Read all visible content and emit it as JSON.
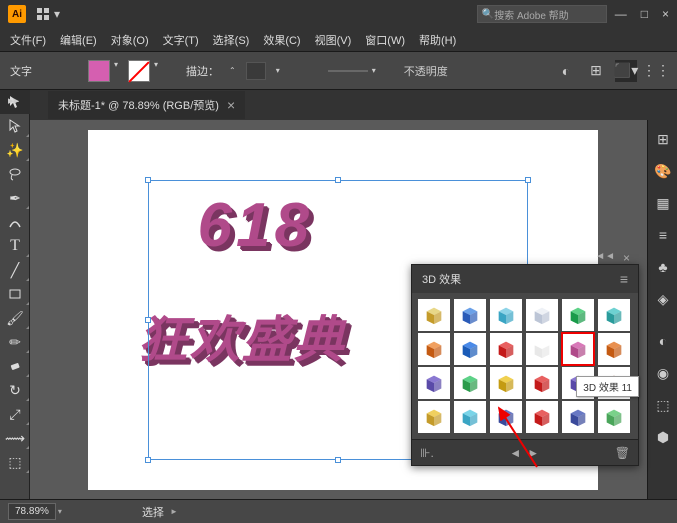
{
  "app": {
    "logo_text": "Ai"
  },
  "search": {
    "icon": "🔍",
    "placeholder": "搜索 Adobe 帮助"
  },
  "window_controls": {
    "min": "—",
    "max": "□",
    "close": "×"
  },
  "menu": {
    "items": [
      {
        "label": "文件(F)"
      },
      {
        "label": "编辑(E)"
      },
      {
        "label": "对象(O)"
      },
      {
        "label": "文字(T)"
      },
      {
        "label": "选择(S)"
      },
      {
        "label": "效果(C)"
      },
      {
        "label": "视图(V)"
      },
      {
        "label": "窗口(W)"
      },
      {
        "label": "帮助(H)"
      }
    ]
  },
  "control_bar": {
    "context_label": "文字",
    "fill_color": "#d55fb0",
    "stroke_label": "描边：",
    "stroke_value": "",
    "opacity_label": "不透明度"
  },
  "tab": {
    "title": "未标题-1* @ 78.89% (RGB/预览)",
    "close": "×"
  },
  "canvas": {
    "text_line1": "618",
    "text_line2": "狂欢盛典"
  },
  "panel_3d": {
    "title": "3D 效果",
    "collapse": "◄◄",
    "menu": "≡",
    "selected_index": 10,
    "tooltip": "3D 效果 11",
    "effects": [
      {
        "c1": "#c49b2a",
        "c2": "#e8d788"
      },
      {
        "c1": "#2a5bb8",
        "c2": "#6aa0e8"
      },
      {
        "c1": "#3aa5c4",
        "c2": "#8ed4e8"
      },
      {
        "c1": "#bcc5d6",
        "c2": "#eef1f6"
      },
      {
        "c1": "#1a9b4a",
        "c2": "#5dd187"
      },
      {
        "c1": "#2a9b9b",
        "c2": "#6ed1d1"
      },
      {
        "c1": "#c45a12",
        "c2": "#f0a060"
      },
      {
        "c1": "#1a5bb8",
        "c2": "#4a8ae8"
      },
      {
        "c1": "#c41a1a",
        "c2": "#e86060"
      },
      {
        "c1": "#e8e8e8",
        "c2": "#ffffff"
      },
      {
        "c1": "#b04a8a",
        "c2": "#d878b8"
      },
      {
        "c1": "#c45a12",
        "c2": "#e89050"
      },
      {
        "c1": "#5a4aa8",
        "c2": "#8a78d1"
      },
      {
        "c1": "#2a9b4a",
        "c2": "#5dd187"
      },
      {
        "c1": "#c49b12",
        "c2": "#f0d050"
      },
      {
        "c1": "#c41a1a",
        "c2": "#e86060"
      },
      {
        "c1": "#5a4aa8",
        "c2": "#8a78d1"
      },
      {
        "c1": "#6a3a28",
        "c2": "#a06850"
      },
      {
        "c1": "#c49b2a",
        "c2": "#f0d060"
      },
      {
        "c1": "#3aa5c4",
        "c2": "#7ad4e8"
      },
      {
        "c1": "#3a4a9b",
        "c2": "#6878c4"
      },
      {
        "c1": "#c41a1a",
        "c2": "#e86060"
      },
      {
        "c1": "#3a4a9b",
        "c2": "#6878c4"
      },
      {
        "c1": "#4aa55a",
        "c2": "#7ad18a"
      }
    ]
  },
  "status_bar": {
    "zoom": "78.89%",
    "mode": "选择"
  }
}
